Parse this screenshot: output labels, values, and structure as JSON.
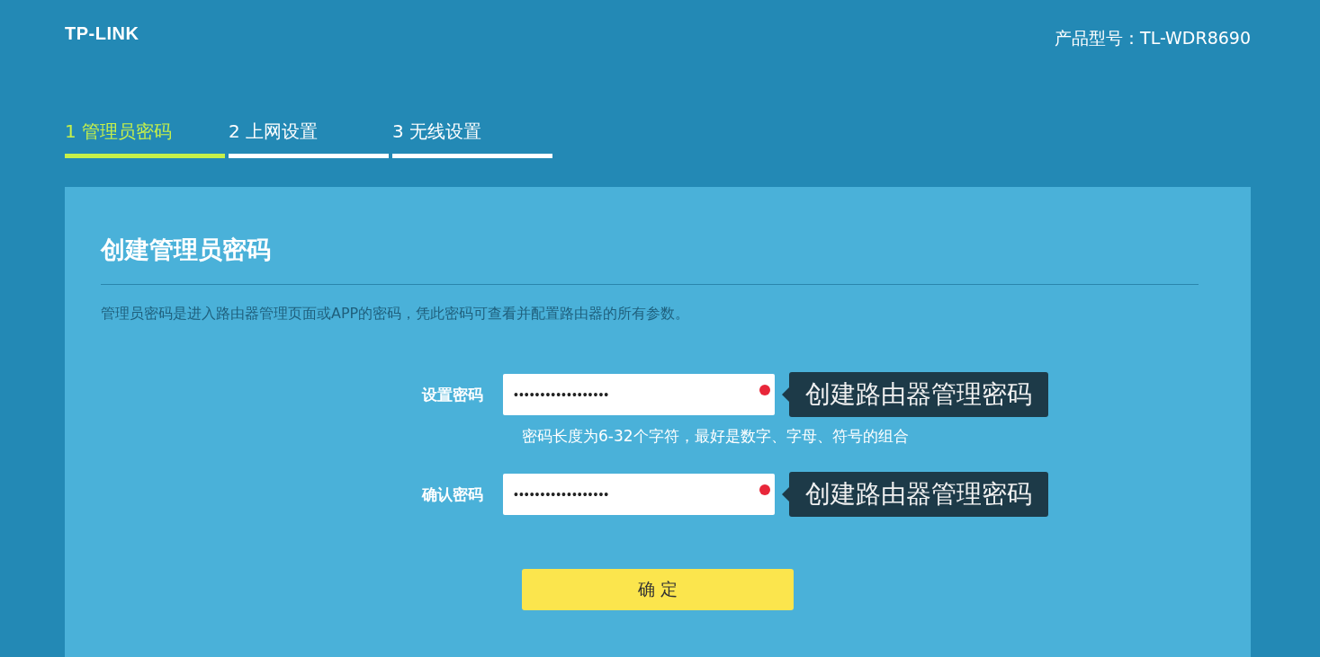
{
  "header": {
    "logo": "TP-LINK",
    "model": "产品型号：TL-WDR8690"
  },
  "steps": [
    {
      "label": "1 管理员密码",
      "selected": true
    },
    {
      "label": "2 上网设置",
      "selected": false
    },
    {
      "label": "3 无线设置",
      "selected": false
    }
  ],
  "panel": {
    "title": "创建管理员密码",
    "description": "管理员密码是进入路由器管理页面或APP的密码，凭此密码可查看并配置路由器的所有参数。",
    "fields": [
      {
        "label": "设置密码",
        "value": "••••••••••••••••••",
        "required": true,
        "tooltip": "创建路由器管理密码",
        "hint": "密码长度为6-32个字符，最好是数字、字母、符号的组合"
      },
      {
        "label": "确认密码",
        "value": "••••••••••••••••••",
        "required": true,
        "tooltip": "创建路由器管理密码"
      }
    ],
    "button": "确 定"
  }
}
